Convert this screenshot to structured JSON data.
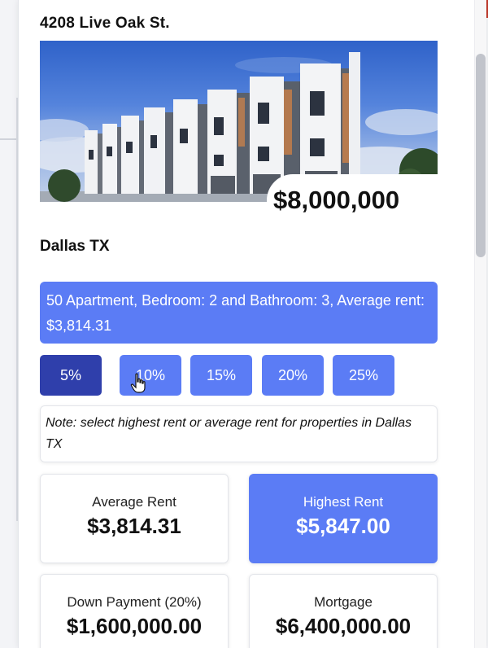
{
  "property": {
    "address": "4208 Live Oak St.",
    "price": "$8,000,000",
    "location": "Dallas TX",
    "details": "50 Apartment, Bedroom: 2 and Bathroom: 3, Average rent: $3,814.31"
  },
  "down_payment_options": {
    "selected": "5%",
    "items": [
      "5%",
      "10%",
      "15%",
      "20%",
      "25%"
    ]
  },
  "note": "Note: select highest rent or average rent for properties in Dallas TX",
  "cards": {
    "average_rent": {
      "label": "Average Rent",
      "value": "$3,814.31"
    },
    "highest_rent": {
      "label": "Highest Rent",
      "value": "$5,847.00"
    },
    "down_payment": {
      "label": "Down Payment (20%)",
      "value": "$1,600,000.00"
    },
    "mortgage": {
      "label": "Mortgage",
      "value": "$6,400,000.00"
    }
  },
  "colors": {
    "accent": "#5b7cf5",
    "accent_active": "#2f3fab"
  },
  "icons": {
    "cursor": "hand-pointer-icon"
  }
}
